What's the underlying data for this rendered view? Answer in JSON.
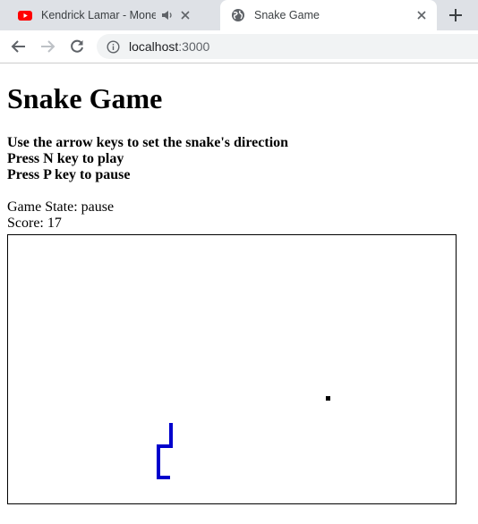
{
  "browser": {
    "tabs": [
      {
        "title": "Kendrick Lamar - Money Trees",
        "favicon": "youtube-icon",
        "audio": true
      },
      {
        "title": "Snake Game",
        "favicon": "globe-icon",
        "active": true
      }
    ],
    "address": {
      "host": "localhost",
      "port": ":3000"
    }
  },
  "page": {
    "title": "Snake Game",
    "instructions": [
      "Use the arrow keys to set the snake's direction",
      "Press N key to play",
      "Press P key to pause"
    ],
    "game_state_label": "Game State: ",
    "game_state": "pause",
    "score_label": "Score: ",
    "score": "17"
  },
  "colors": {
    "snake": "#0000cc",
    "food": "#000000"
  }
}
